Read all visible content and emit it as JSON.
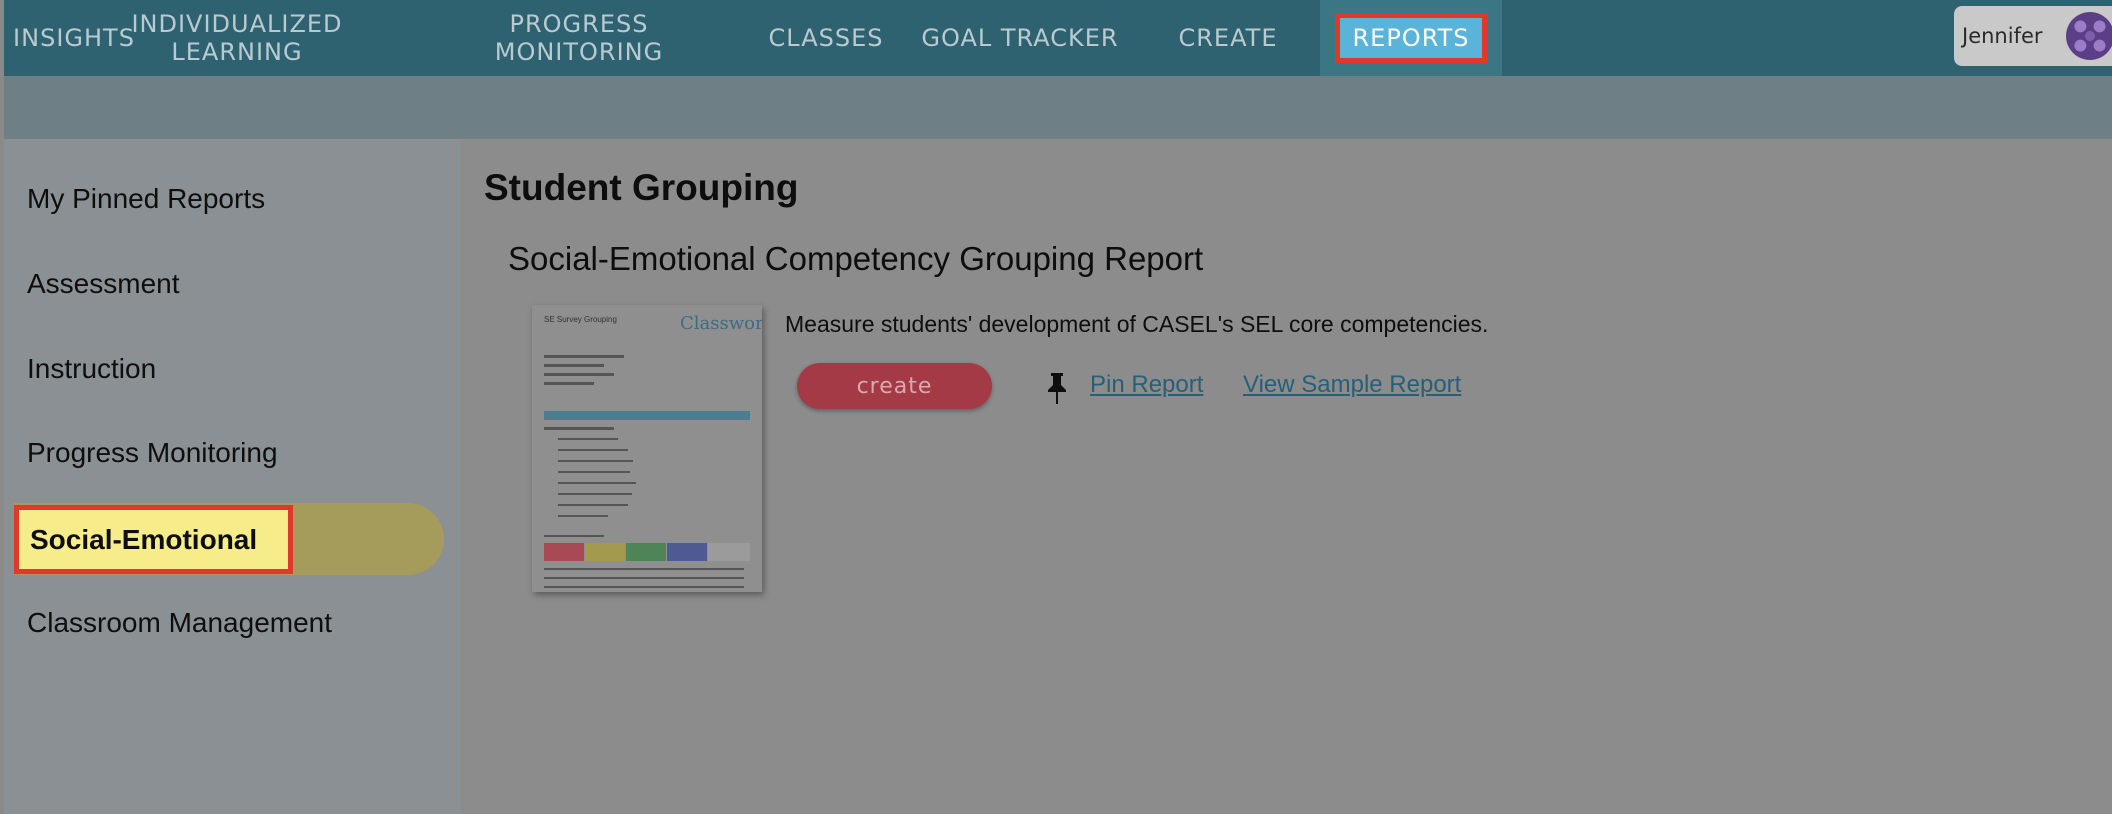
{
  "nav": {
    "items": [
      {
        "label": "INSIGHTS"
      },
      {
        "label": "INDIVIDUALIZED LEARNING"
      },
      {
        "label": "PROGRESS MONITORING"
      },
      {
        "label": "CLASSES"
      },
      {
        "label": "GOAL TRACKER"
      },
      {
        "label": "CREATE"
      },
      {
        "label": "REPORTS"
      }
    ],
    "active": "REPORTS",
    "user_name": "Jennifer"
  },
  "sidebar": {
    "items": [
      {
        "label": "My Pinned Reports"
      },
      {
        "label": "Assessment"
      },
      {
        "label": "Instruction"
      },
      {
        "label": "Progress Monitoring"
      },
      {
        "label": "Social-Emotional"
      },
      {
        "label": "Classroom Management"
      }
    ],
    "active": "Social-Emotional"
  },
  "main": {
    "page_title": "Student Grouping",
    "report": {
      "title": "Social-Emotional Competency Grouping Report",
      "description": "Measure students' development of CASEL's SEL core competencies.",
      "create_label": "create",
      "pin_label": "Pin Report",
      "sample_label": "View Sample Report",
      "thumbnail": {
        "heading": "SE Survey Grouping",
        "logo": "Classworks"
      }
    }
  },
  "colors": {
    "nav_bg": "#2f6270",
    "active_highlight": "#5ab3d8",
    "annotation_border": "#e0392b",
    "create_button": "#a33a45",
    "link": "#265f7a"
  }
}
